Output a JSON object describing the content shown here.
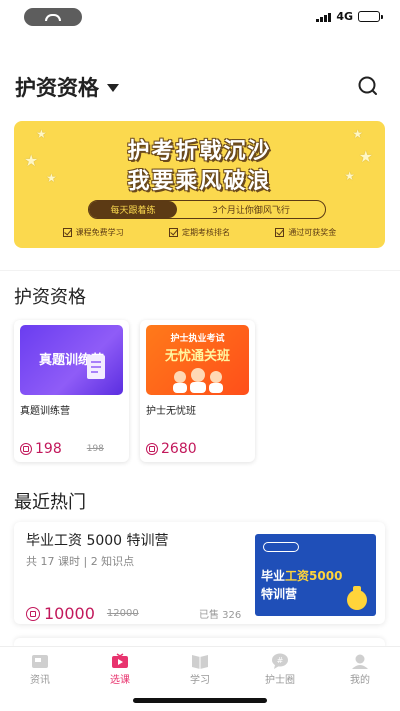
{
  "status_bar": {
    "network": "4G"
  },
  "header": {
    "title": "护资资格"
  },
  "banner": {
    "line1": "护考折戟沉沙",
    "line2": "我要乘风破浪",
    "slogan_left": "每天跟着练",
    "slogan_right": "3个月让你御风飞行",
    "perks": [
      "课程免费学习",
      "定期考核排名",
      "通过可获奖金"
    ],
    "bg_color": "#fbd94e"
  },
  "section_qualification": {
    "title": "护资资格",
    "cards": [
      {
        "thumb_title": "真题训练营",
        "name": "真题训练营",
        "price": "198",
        "original_price": "198"
      },
      {
        "thumb_title_top": "护士执业考试",
        "thumb_title": "无忧通关班",
        "name": "护士无忧班",
        "price": "2680"
      }
    ]
  },
  "section_hot": {
    "title": "最近热门",
    "items": [
      {
        "title": "毕业工资 5000 特训营",
        "meta": "共 17 课时 | 2 知识点",
        "price": "10000",
        "original_price": "12000",
        "sold": "已售 326",
        "image_line1_prefix": "毕业",
        "image_line1_highlight": "工资5000",
        "image_line2": "特训营"
      }
    ]
  },
  "tabbar": {
    "items": [
      {
        "label": "资讯",
        "icon": "news-icon",
        "active": false
      },
      {
        "label": "选课",
        "icon": "course-icon",
        "active": true
      },
      {
        "label": "学习",
        "icon": "book-icon",
        "active": false
      },
      {
        "label": "护士圈",
        "icon": "community-icon",
        "active": false
      },
      {
        "label": "我的",
        "icon": "profile-icon",
        "active": false
      }
    ]
  },
  "colors": {
    "accent": "#e8336e",
    "price": "#c2185b"
  }
}
